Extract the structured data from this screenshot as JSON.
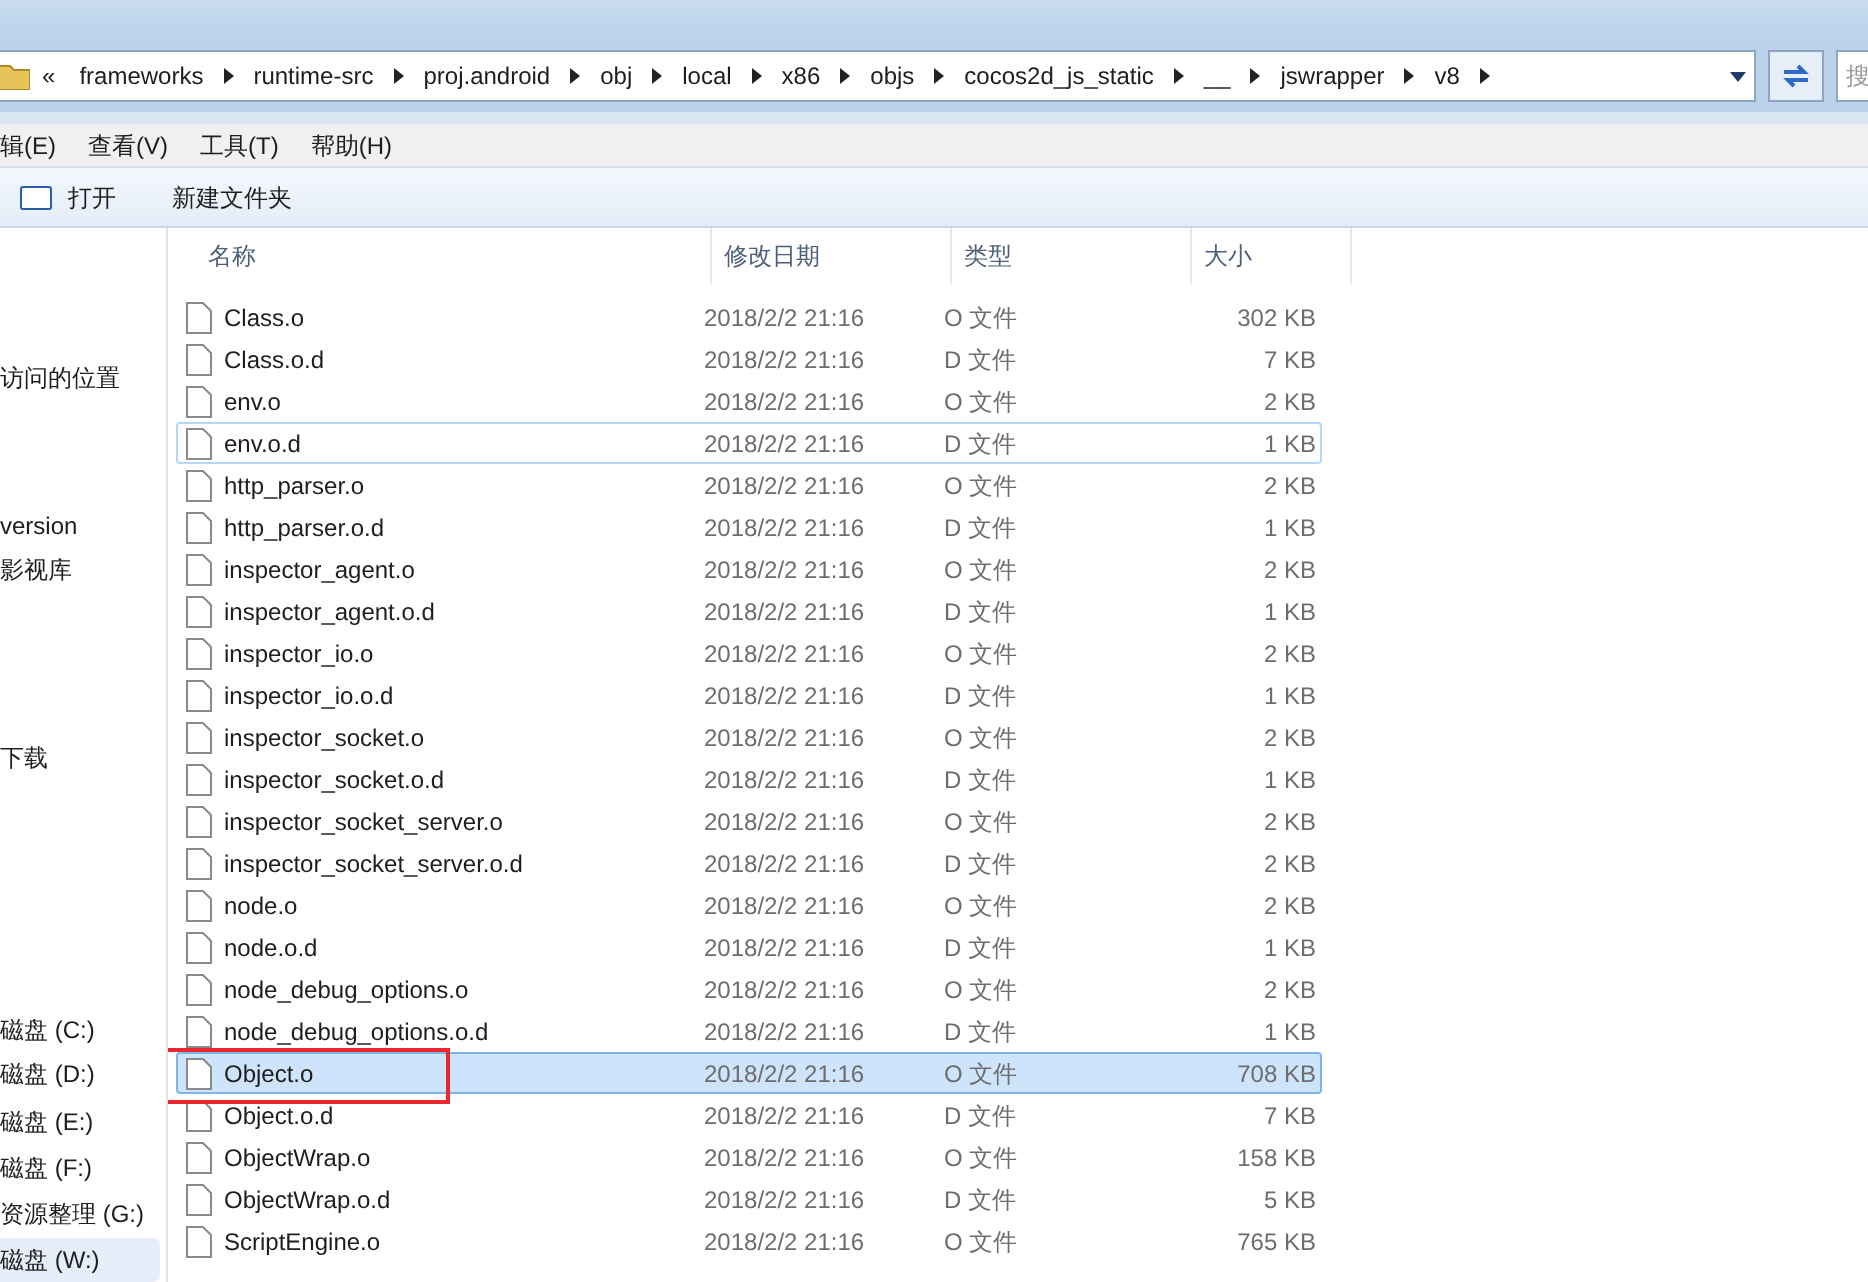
{
  "address_bar": {
    "overflow": "«",
    "crumbs": [
      "frameworks",
      "runtime-src",
      "proj.android",
      "obj",
      "local",
      "x86",
      "objs",
      "cocos2d_js_static",
      "__",
      "jswrapper",
      "v8"
    ]
  },
  "search": {
    "placeholder": "搜"
  },
  "menu": [
    "辑(E)",
    "查看(V)",
    "工具(T)",
    "帮助(H)"
  ],
  "toolbar": [
    "打开",
    "新建文件夹"
  ],
  "sidebar": {
    "items": [
      {
        "label": "访问的位置",
        "selected": false
      },
      {
        "label": "version",
        "selected": false
      },
      {
        "label": "影视库",
        "selected": false
      },
      {
        "label": "下载",
        "selected": false
      },
      {
        "label": "磁盘 (C:)",
        "selected": false
      },
      {
        "label": "磁盘 (D:)",
        "selected": false
      },
      {
        "label": "磁盘 (E:)",
        "selected": false
      },
      {
        "label": "磁盘 (F:)",
        "selected": false
      },
      {
        "label": "资源整理 (G:)",
        "selected": false
      },
      {
        "label": "磁盘 (W:)",
        "selected": true
      }
    ]
  },
  "table": {
    "columns": [
      "名称",
      "修改日期",
      "类型",
      "大小"
    ],
    "rows": [
      {
        "name": "Class.o",
        "date": "2018/2/2 21:16",
        "type": "O 文件",
        "size": "302 KB",
        "selected": false,
        "hover": false
      },
      {
        "name": "Class.o.d",
        "date": "2018/2/2 21:16",
        "type": "D 文件",
        "size": "7 KB",
        "selected": false,
        "hover": false
      },
      {
        "name": "env.o",
        "date": "2018/2/2 21:16",
        "type": "O 文件",
        "size": "2 KB",
        "selected": false,
        "hover": false
      },
      {
        "name": "env.o.d",
        "date": "2018/2/2 21:16",
        "type": "D 文件",
        "size": "1 KB",
        "selected": false,
        "hover": true
      },
      {
        "name": "http_parser.o",
        "date": "2018/2/2 21:16",
        "type": "O 文件",
        "size": "2 KB",
        "selected": false,
        "hover": false
      },
      {
        "name": "http_parser.o.d",
        "date": "2018/2/2 21:16",
        "type": "D 文件",
        "size": "1 KB",
        "selected": false,
        "hover": false
      },
      {
        "name": "inspector_agent.o",
        "date": "2018/2/2 21:16",
        "type": "O 文件",
        "size": "2 KB",
        "selected": false,
        "hover": false
      },
      {
        "name": "inspector_agent.o.d",
        "date": "2018/2/2 21:16",
        "type": "D 文件",
        "size": "1 KB",
        "selected": false,
        "hover": false
      },
      {
        "name": "inspector_io.o",
        "date": "2018/2/2 21:16",
        "type": "O 文件",
        "size": "2 KB",
        "selected": false,
        "hover": false
      },
      {
        "name": "inspector_io.o.d",
        "date": "2018/2/2 21:16",
        "type": "D 文件",
        "size": "1 KB",
        "selected": false,
        "hover": false
      },
      {
        "name": "inspector_socket.o",
        "date": "2018/2/2 21:16",
        "type": "O 文件",
        "size": "2 KB",
        "selected": false,
        "hover": false
      },
      {
        "name": "inspector_socket.o.d",
        "date": "2018/2/2 21:16",
        "type": "D 文件",
        "size": "1 KB",
        "selected": false,
        "hover": false
      },
      {
        "name": "inspector_socket_server.o",
        "date": "2018/2/2 21:16",
        "type": "O 文件",
        "size": "2 KB",
        "selected": false,
        "hover": false
      },
      {
        "name": "inspector_socket_server.o.d",
        "date": "2018/2/2 21:16",
        "type": "D 文件",
        "size": "2 KB",
        "selected": false,
        "hover": false
      },
      {
        "name": "node.o",
        "date": "2018/2/2 21:16",
        "type": "O 文件",
        "size": "2 KB",
        "selected": false,
        "hover": false
      },
      {
        "name": "node.o.d",
        "date": "2018/2/2 21:16",
        "type": "D 文件",
        "size": "1 KB",
        "selected": false,
        "hover": false
      },
      {
        "name": "node_debug_options.o",
        "date": "2018/2/2 21:16",
        "type": "O 文件",
        "size": "2 KB",
        "selected": false,
        "hover": false
      },
      {
        "name": "node_debug_options.o.d",
        "date": "2018/2/2 21:16",
        "type": "D 文件",
        "size": "1 KB",
        "selected": false,
        "hover": false
      },
      {
        "name": "Object.o",
        "date": "2018/2/2 21:16",
        "type": "O 文件",
        "size": "708 KB",
        "selected": true,
        "hover": false,
        "annotated": true
      },
      {
        "name": "Object.o.d",
        "date": "2018/2/2 21:16",
        "type": "D 文件",
        "size": "7 KB",
        "selected": false,
        "hover": false
      },
      {
        "name": "ObjectWrap.o",
        "date": "2018/2/2 21:16",
        "type": "O 文件",
        "size": "158 KB",
        "selected": false,
        "hover": false
      },
      {
        "name": "ObjectWrap.o.d",
        "date": "2018/2/2 21:16",
        "type": "D 文件",
        "size": "5 KB",
        "selected": false,
        "hover": false
      },
      {
        "name": "ScriptEngine.o",
        "date": "2018/2/2 21:16",
        "type": "O 文件",
        "size": "765 KB",
        "selected": false,
        "hover": false
      }
    ]
  }
}
